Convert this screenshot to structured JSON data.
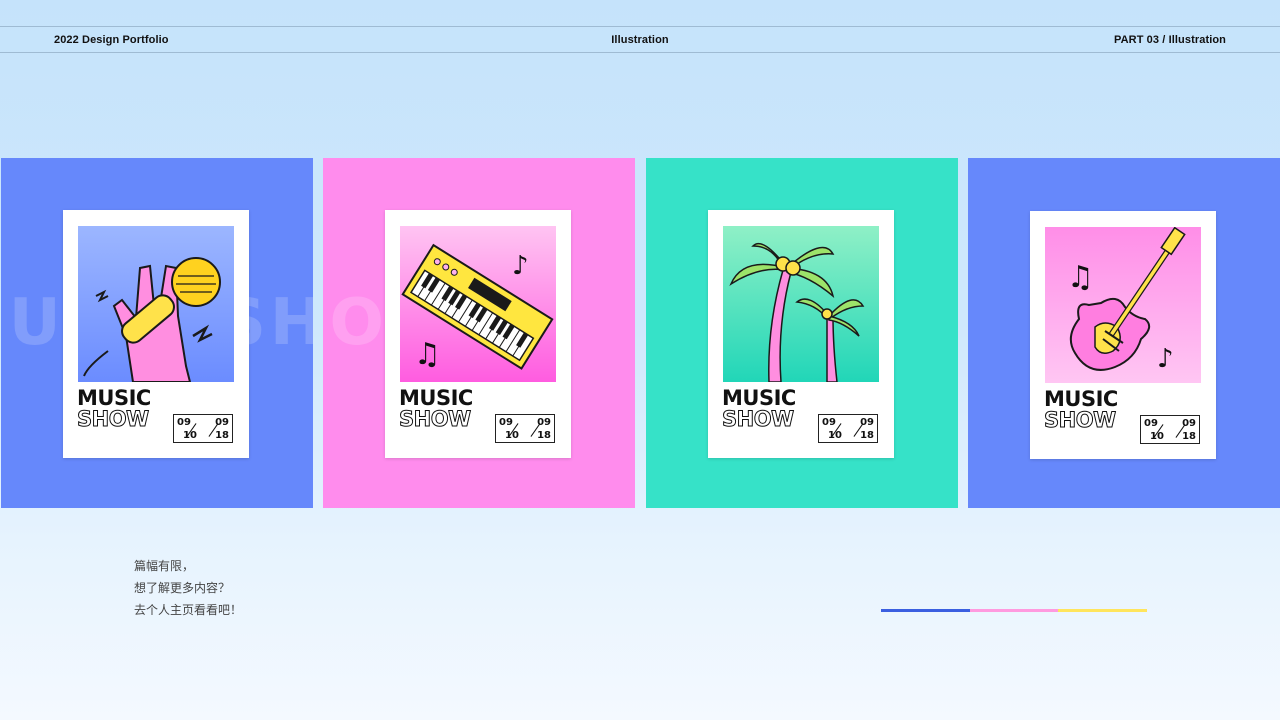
{
  "header": {
    "left": "2022 Design Portfolio",
    "center": "Illustration",
    "right": "PART 03 / Illustration"
  },
  "watermark": "MUSIC SHOW",
  "cards": [
    {
      "title1": "MUSIC",
      "title2": "SHOW",
      "date_top_left": "09",
      "date_top_right": "09",
      "date_bottom_left": "10",
      "date_bottom_right": "18",
      "illustration": "microphone-icon"
    },
    {
      "title1": "MUSIC",
      "title2": "SHOW",
      "date_top_left": "09",
      "date_top_right": "09",
      "date_bottom_left": "10",
      "date_bottom_right": "18",
      "illustration": "keyboard-icon"
    },
    {
      "title1": "MUSIC",
      "title2": "SHOW",
      "date_top_left": "09",
      "date_top_right": "09",
      "date_bottom_left": "10",
      "date_bottom_right": "18",
      "illustration": "palm-tree-icon"
    },
    {
      "title1": "MUSIC",
      "title2": "SHOW",
      "date_top_left": "09",
      "date_top_right": "09",
      "date_bottom_left": "10",
      "date_bottom_right": "18",
      "illustration": "guitar-icon"
    }
  ],
  "footer": {
    "line1": "篇幅有限，",
    "line2": "想了解更多内容？",
    "line3": "去个人主页看看吧！"
  },
  "colors": {
    "blue": "#6688fb",
    "pink": "#ff8ced",
    "teal": "#36e2c8",
    "bar_blue": "#3b5fe0",
    "bar_pink": "#ff9adf",
    "bar_yellow": "#ffe55c"
  }
}
